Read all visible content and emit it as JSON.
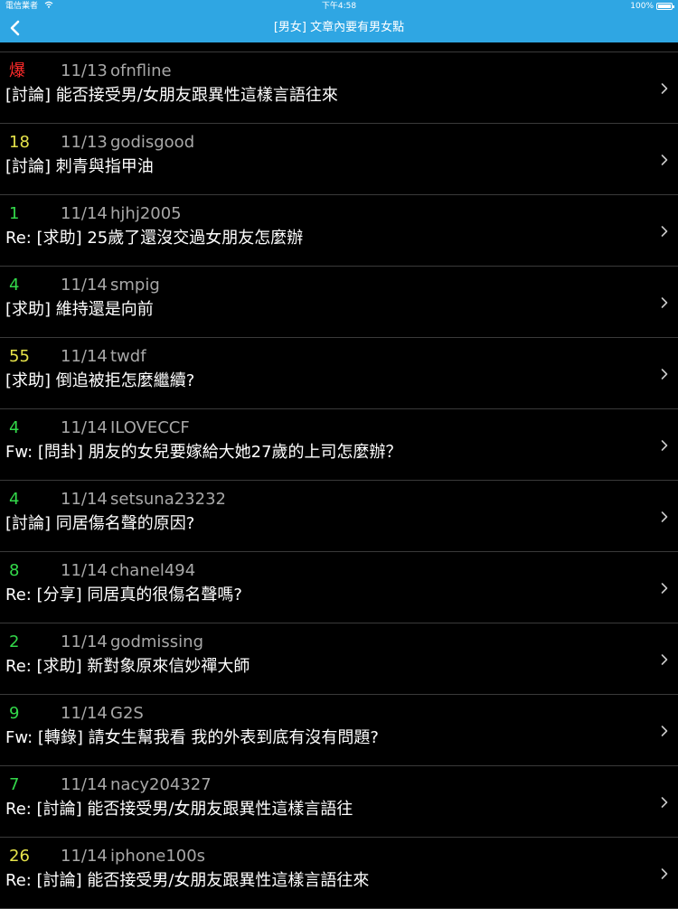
{
  "status_bar": {
    "carrier": "電信業者",
    "time": "下午4:58",
    "battery": "100%"
  },
  "nav": {
    "title": "[男女] 文章內要有男女點"
  },
  "colors": {
    "accent": "#2fa6e3",
    "hot": "#ff2a2a",
    "yellow": "#e6e34a",
    "green": "#33d94a",
    "meta_gray": "#a8a8a8"
  },
  "posts": [
    {
      "count": "爆",
      "count_color": "#ff2a2a",
      "date": "11/13",
      "author": "ofnfline",
      "title": "[討論] 能否接受男/女朋友跟異性這樣言語往來"
    },
    {
      "count": "18",
      "count_color": "#e6e34a",
      "date": "11/13",
      "author": "godisgood",
      "title": "[討論] 刺青與指甲油"
    },
    {
      "count": "1",
      "count_color": "#33d94a",
      "date": "11/14",
      "author": "hjhj2005",
      "title": "Re: [求助] 25歲了還沒交過女朋友怎麼辦"
    },
    {
      "count": "4",
      "count_color": "#33d94a",
      "date": "11/14",
      "author": "smpig",
      "title": "[求助] 維持還是向前"
    },
    {
      "count": "55",
      "count_color": "#e6e34a",
      "date": "11/14",
      "author": "twdf",
      "title": "[求助] 倒追被拒怎麼繼續?"
    },
    {
      "count": "4",
      "count_color": "#33d94a",
      "date": "11/14",
      "author": "ILOVECCF",
      "title": "Fw: [問卦] 朋友的女兒要嫁給大她27歲的上司怎麼辦？"
    },
    {
      "count": "4",
      "count_color": "#33d94a",
      "date": "11/14",
      "author": "setsuna23232",
      "title": "[討論] 同居傷名聲的原因?"
    },
    {
      "count": "8",
      "count_color": "#33d94a",
      "date": "11/14",
      "author": "chanel494",
      "title": "Re: [分享] 同居真的很傷名聲嗎?"
    },
    {
      "count": "2",
      "count_color": "#33d94a",
      "date": "11/14",
      "author": "godmissing",
      "title": "Re: [求助] 新對象原來信妙禪大師"
    },
    {
      "count": "9",
      "count_color": "#33d94a",
      "date": "11/14",
      "author": "G2S",
      "title": "Fw: [轉錄] 請女生幫我看 我的外表到底有沒有問題?"
    },
    {
      "count": "7",
      "count_color": "#33d94a",
      "date": "11/14",
      "author": "nacy204327",
      "title": "Re: [討論] 能否接受男/女朋友跟異性這樣言語往"
    },
    {
      "count": "26",
      "count_color": "#e6e34a",
      "date": "11/14",
      "author": "iphone100s",
      "title": "Re: [討論] 能否接受男/女朋友跟異性這樣言語往來"
    }
  ]
}
